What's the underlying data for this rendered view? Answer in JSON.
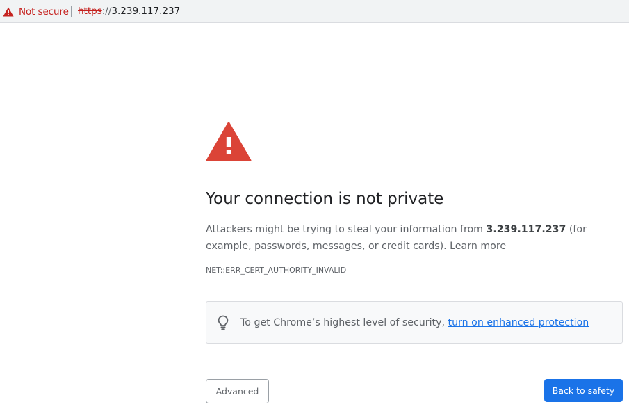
{
  "addressbar": {
    "security_label": "Not secure",
    "url_scheme": "https",
    "url_separator": "://",
    "url_host": "3.239.117.237",
    "security_color": "#c5221f"
  },
  "interstitial": {
    "warning_icon": "warning-triangle-icon",
    "warning_color": "#db4437",
    "heading": "Your connection is not private",
    "explanation_before": "Attackers might be trying to steal your information from ",
    "explanation_host": "3.239.117.237",
    "explanation_after": " (for example, passwords, messages, or credit cards). ",
    "learn_more": "Learn more",
    "error_code": "NET::ERR_CERT_AUTHORITY_INVALID",
    "enhanced_icon": "lightbulb-icon",
    "enhanced_text": "To get Chrome’s highest level of security, ",
    "enhanced_link": "turn on enhanced protection",
    "advanced_button": "Advanced",
    "back_button": "Back to safety",
    "accent_color": "#1a73e8"
  }
}
